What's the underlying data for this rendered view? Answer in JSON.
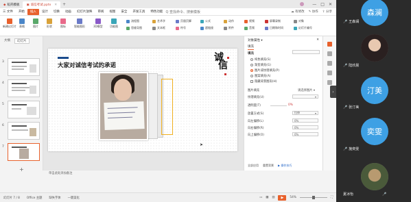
{
  "titlebar": {
    "home_tab": "稻壳模板",
    "doc_tab": "诚信考试.pptx",
    "plus": "+",
    "controls": [
      "—",
      "□",
      "✕"
    ]
  },
  "menu": {
    "items": [
      "三 文件",
      "开始",
      "插入",
      "设计",
      "切换",
      "动画",
      "幻灯片放映",
      "审阅",
      "视图",
      "安全",
      "开发工具",
      "特色功能"
    ],
    "active_index": 2,
    "search": "Q 查找命令、搜索模板",
    "right": [
      "☁ 有修改",
      "✎ 协作",
      "⇧ 分享"
    ]
  },
  "ribbon": {
    "big_buttons": [
      "新建幻灯片",
      "表格",
      "图片",
      "形状",
      "图标",
      "智能图形",
      "3D模型",
      "功能图"
    ],
    "small_buttons": [
      "流程图",
      "思维导图",
      "艺术字",
      "文本框",
      "页眉页脚",
      "符号",
      "公式",
      "超链接",
      "动作",
      "附件",
      "视频",
      "音频",
      "屏幕录制",
      "日期和时间",
      "对象",
      "幻灯片编号"
    ],
    "font_name": "",
    "font_size": "0"
  },
  "thumbs": {
    "tabs": [
      "大纲",
      "幻灯片"
    ],
    "numbers": [
      "3",
      "4",
      "5",
      "6",
      "7"
    ],
    "active": 4,
    "add": "+"
  },
  "slide": {
    "title": "大家对诚信考试的承诺",
    "calligraphy_1": "诚",
    "calligraphy_2": "信"
  },
  "notes_placeholder": "单击此处添加备注",
  "props": {
    "title": "对象属性 ▾",
    "close": "✕",
    "tab": "填充",
    "section": "填充",
    "options": [
      "纯色填充(S)",
      "渐变填充(G)",
      "图片或纹理填充(P)",
      "图案填充(A)",
      "隐藏背景图形(H)"
    ],
    "selected_option": 2,
    "source_label": "图片填充",
    "source_value": "请选择图片 ▾",
    "tiling_label": "纹理填充(U)",
    "transparency_label": "透明度(T)",
    "transparency_value": "0%",
    "stretch_label": "放置方式(S)",
    "stretch_value": "拉伸",
    "offsets": [
      {
        "label": "向左偏移(L)",
        "value": "0%"
      },
      {
        "label": "向右偏移(R)",
        "value": "0%"
      },
      {
        "label": "向上偏移(O)",
        "value": "0%"
      }
    ],
    "footer": [
      "全部应用",
      "重置背景",
      "▶ 操作技巧"
    ]
  },
  "status": {
    "slide_info": "幻灯片 7 / 8",
    "theme": "Office 主题",
    "font_missing": "缺失字体",
    "beautify": "一键美化",
    "zoom": "54%",
    "play": "▶"
  },
  "participants": [
    {
      "avatar_text": "森澜",
      "name": "王森澜",
      "color": "#3ea0e4",
      "kind": "text"
    },
    {
      "avatar_text": "",
      "name": "陆欣晨",
      "color": "#7a6a66",
      "kind": "photo"
    },
    {
      "avatar_text": "汀美",
      "name": "张汀美",
      "color": "#3ea0e4",
      "kind": "text"
    },
    {
      "avatar_text": "奕雯",
      "name": "施奕雯",
      "color": "#3ea0e4",
      "kind": "text"
    },
    {
      "avatar_text": "",
      "name": "夏冰怡",
      "color": "#8b8478",
      "kind": "photo"
    }
  ]
}
